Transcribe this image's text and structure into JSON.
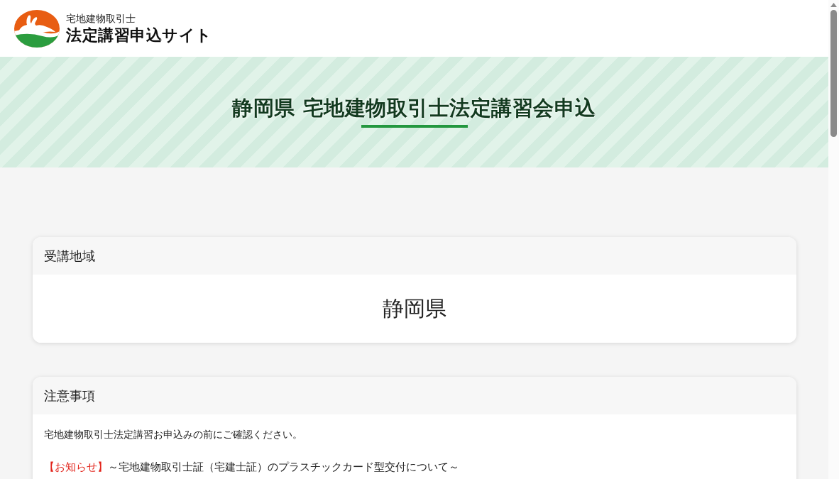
{
  "site": {
    "subtitle": "宅地建物取引士",
    "title": "法定講習申込サイト"
  },
  "banner": {
    "title": "静岡県 宅地建物取引士法定講習会申込"
  },
  "sections": [
    {
      "kind": "value",
      "heading": "受講地域",
      "value": "静岡県"
    },
    {
      "kind": "notes",
      "heading": "注意事項",
      "intro": "宅地建物取引士法定講習お申込みの前にご確認ください。",
      "notice": {
        "label": "【お知らせ】",
        "text": "～宅地建物取引士証（宅建士証）のプラスチックカード型交付について～"
      }
    }
  ]
}
